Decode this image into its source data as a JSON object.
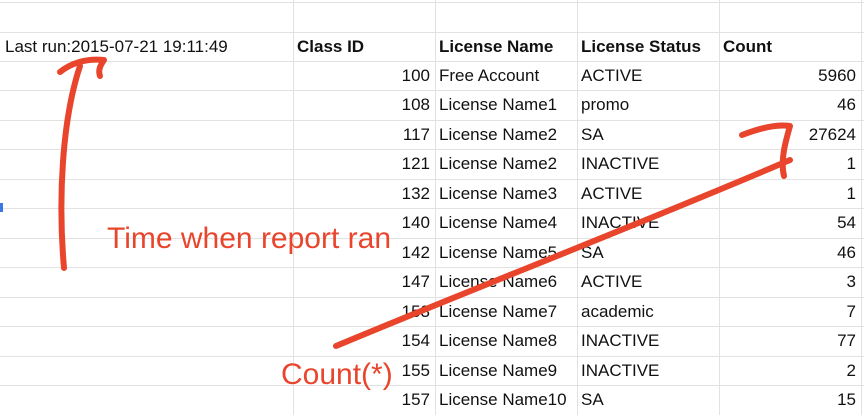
{
  "report": {
    "last_run_label": "Last run:2015-07-21 19:11:49"
  },
  "table": {
    "columns": [
      "Class ID",
      "License Name",
      "License Status",
      "Count"
    ],
    "rows": [
      [
        "100",
        "Free Account",
        "ACTIVE",
        "5960"
      ],
      [
        "108",
        "License Name1",
        "promo",
        "46"
      ],
      [
        "117",
        "License Name2",
        "SA",
        "27624"
      ],
      [
        "121",
        "License Name2",
        "INACTIVE",
        "1"
      ],
      [
        "132",
        "License Name3",
        "ACTIVE",
        "1"
      ],
      [
        "140",
        "License Name4",
        "INACTIVE",
        "54"
      ],
      [
        "142",
        "License Name5",
        "SA",
        "46"
      ],
      [
        "147",
        "License Name6",
        "ACTIVE",
        "3"
      ],
      [
        "153",
        "License Name7",
        "academic",
        "7"
      ],
      [
        "154",
        "License Name8",
        "INACTIVE",
        "77"
      ],
      [
        "155",
        "License Name9",
        "INACTIVE",
        "2"
      ],
      [
        "157",
        "License Name10",
        "SA",
        "15"
      ]
    ]
  },
  "annotations": {
    "time_label": "Time when report ran",
    "count_label": "Count(*)"
  },
  "colors": {
    "annotation": "#e8452c",
    "gridline": "#e2e2e2",
    "selection_marker": "#3b78e7"
  }
}
